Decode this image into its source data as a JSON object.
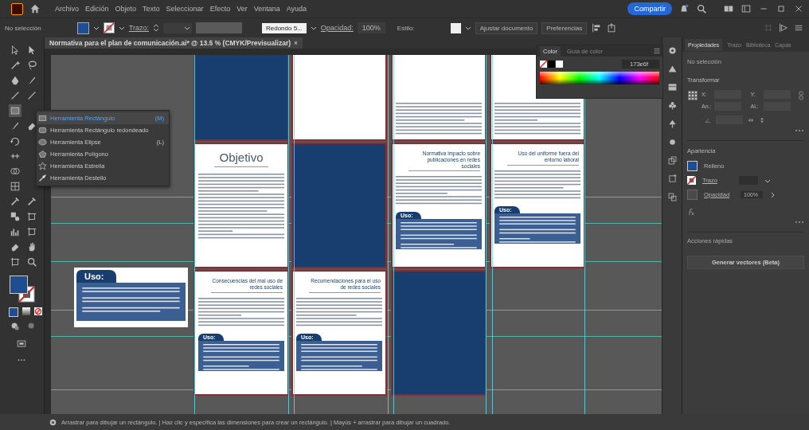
{
  "menu": [
    "Archivo",
    "Edición",
    "Objeto",
    "Texto",
    "Seleccionar",
    "Efecto",
    "Ver",
    "Ventana",
    "Ayuda"
  ],
  "share": "Compartir",
  "control_bar": {
    "selection": "No selección",
    "stroke_label": "Trazo:",
    "brush": "Redondo 5...",
    "opacity_label": "Opacidad:",
    "opacity": "100%",
    "style_label": "Estilo:",
    "buttons": [
      "Ajustar documento",
      "Preferencias"
    ]
  },
  "document_tab": {
    "title": "Normativa para el plan de comunicación.ai* @ 13.5 % (CMYK/Previsualizar)",
    "close": "×"
  },
  "tool_flyout": [
    {
      "label": "Herramienta Rectángulo",
      "shortcut": "(M)",
      "selected": true
    },
    {
      "label": "Herramienta Rectángulo redondeado",
      "selected": false
    },
    {
      "label": "Herramienta Elipse",
      "shortcut": "(L)",
      "selected": false
    },
    {
      "label": "Herramienta Polígono",
      "selected": false
    },
    {
      "label": "Herramienta Estrella",
      "selected": false
    },
    {
      "label": "Herramienta Destello",
      "selected": false
    }
  ],
  "artboards": [
    {
      "kind": "blue"
    },
    {
      "kind": "blank"
    },
    {
      "kind": "text"
    },
    {
      "kind": "text"
    },
    {
      "kind": "text",
      "title": "Objetivo",
      "big_title": true
    },
    {
      "kind": "blue"
    },
    {
      "kind": "text",
      "title": "Normativa impacto sobre publicaciones en redes sociales",
      "uso": "Uso:"
    },
    {
      "kind": "text",
      "title": "Uso del uniforme fuera del entorno laboral",
      "uso": "Uso:"
    },
    {
      "kind": "text",
      "title": "Consecuencias del mal uso de redes sociales",
      "uso": "Uso:"
    },
    {
      "kind": "text",
      "title": "Recomendaciones para el uso de redes sociales",
      "uso": "Uso:"
    },
    {
      "kind": "blue"
    }
  ],
  "floating_card": {
    "uso": "Uso:"
  },
  "color_panel": {
    "tabs": [
      {
        "label": "Color",
        "selected": true
      },
      {
        "label": "Guía de color",
        "selected": false
      }
    ],
    "hex": "173e6f"
  },
  "properties_panel": {
    "tabs": [
      {
        "label": "Propiedades",
        "selected": true
      },
      {
        "label": "Trazo",
        "selected": false
      },
      {
        "label": "Biblioteca",
        "selected": false
      },
      {
        "label": "Capas",
        "selected": false
      }
    ],
    "selection": "No selección",
    "transform": "Transformar",
    "fields": [
      "X:",
      "Y:",
      "An.:",
      "Al.:"
    ],
    "appearance": "Apariencia",
    "fill": "Relleno",
    "stroke": "Trazo",
    "opacity": "Opacidad",
    "opacity_value": "100%",
    "quick_actions": "Acciones rápidas",
    "generate": "Generar vectores (Beta)"
  },
  "status_bar": "Arrastrar para dibujar un rectángulo. | Haz clic y especifica las dimensiones para crear un rectángulo. | Mayús + arrastrar para dibujar un cuadrado."
}
